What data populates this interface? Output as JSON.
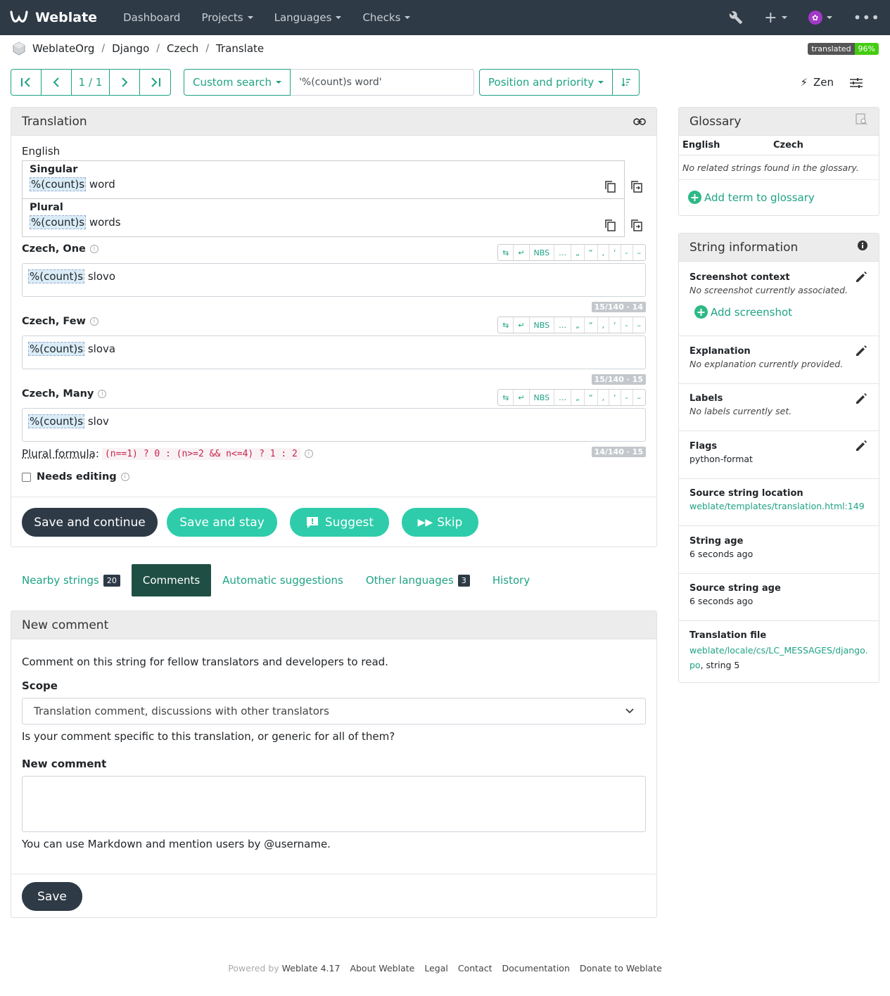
{
  "nav": {
    "brand": "Weblate",
    "items": [
      "Dashboard",
      "Projects",
      "Languages",
      "Checks"
    ]
  },
  "breadcrumb": [
    "WeblateOrg",
    "Django",
    "Czech",
    "Translate"
  ],
  "badge": {
    "label": "translated",
    "value": "96%"
  },
  "toolbar": {
    "position": "1 / 1",
    "search_button": "Custom search",
    "search_value": "'%(count)s word'",
    "sort_button": "Position and priority",
    "zen": "Zen"
  },
  "translation": {
    "title": "Translation",
    "source_language": "English",
    "sources": [
      {
        "label": "Singular",
        "placeholder": "%(count)s",
        "text": " word"
      },
      {
        "label": "Plural",
        "placeholder": "%(count)s",
        "text": " words"
      }
    ],
    "keys": [
      "⇆",
      "↵",
      "NBS",
      "…",
      "„",
      "“",
      "‚",
      "‘",
      "‐",
      "–"
    ],
    "targets": [
      {
        "label": "Czech, One",
        "placeholder": "%(count)s",
        "text": " slovo",
        "counter": "15/140 · 14"
      },
      {
        "label": "Czech, Few",
        "placeholder": "%(count)s",
        "text": " slova",
        "counter": "15/140 · 15"
      },
      {
        "label": "Czech, Many",
        "placeholder": "%(count)s",
        "text": " slov",
        "counter": "14/140 · 15"
      }
    ],
    "plural_formula_label": "Plural formula",
    "plural_formula": "(n==1) ? 0 : (n>=2 && n<=4) ? 1 : 2",
    "needs_editing": "Needs editing",
    "buttons": {
      "save_continue": "Save and continue",
      "save_stay": "Save and stay",
      "suggest": "Suggest",
      "skip": "Skip"
    }
  },
  "tabs": [
    {
      "label": "Nearby strings",
      "count": "20"
    },
    {
      "label": "Comments",
      "count": null
    },
    {
      "label": "Automatic suggestions",
      "count": null
    },
    {
      "label": "Other languages",
      "count": "3"
    },
    {
      "label": "History",
      "count": null
    }
  ],
  "comment": {
    "title": "New comment",
    "description": "Comment on this string for fellow translators and developers to read.",
    "scope_label": "Scope",
    "scope_value": "Translation comment, discussions with other translators",
    "scope_help": "Is your comment specific to this translation, or generic for all of them?",
    "comment_label": "New comment",
    "markdown_help": "You can use Markdown and mention users by @username.",
    "save": "Save"
  },
  "glossary": {
    "title": "Glossary",
    "col_source": "English",
    "col_target": "Czech",
    "empty": "No related strings found in the glossary.",
    "add": "Add term to glossary"
  },
  "string_info": {
    "title": "String information",
    "screenshot_title": "Screenshot context",
    "screenshot_value": "No screenshot currently associated.",
    "add_screenshot": "Add screenshot",
    "explanation_title": "Explanation",
    "explanation_value": "No explanation currently provided.",
    "labels_title": "Labels",
    "labels_value": "No labels currently set.",
    "flags_title": "Flags",
    "flags_value": "python-format",
    "location_title": "Source string location",
    "location_value": "weblate/templates/translation.html:149",
    "age_title": "String age",
    "age_value": "6 seconds ago",
    "source_age_title": "Source string age",
    "source_age_value": "6 seconds ago",
    "file_title": "Translation file",
    "file_link": "weblate/locale/cs/LC_MESSAGES/django.po",
    "file_suffix": ", string 5"
  },
  "footer": {
    "powered": "Powered by",
    "links": [
      "Weblate 4.17",
      "About Weblate",
      "Legal",
      "Contact",
      "Documentation",
      "Donate to Weblate"
    ]
  }
}
